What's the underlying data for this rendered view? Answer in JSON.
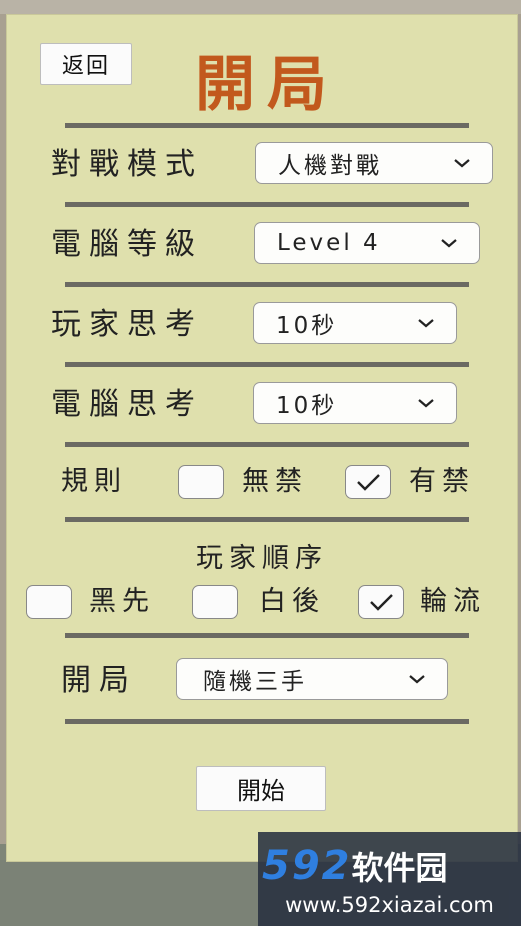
{
  "back_button": {
    "label": "返回"
  },
  "title": "開局",
  "rows": {
    "mode": {
      "label": "對戰模式",
      "value": "人機對戰"
    },
    "level": {
      "label": "電腦等級",
      "value": "Level 4"
    },
    "player_think": {
      "label": "玩家思考",
      "value": "10秒"
    },
    "computer_think": {
      "label": "電腦思考",
      "value": "10秒"
    },
    "rules": {
      "label": "規則",
      "options": [
        {
          "label": "無禁",
          "checked": false
        },
        {
          "label": "有禁",
          "checked": true
        }
      ]
    },
    "order": {
      "label": "玩家順序",
      "options": [
        {
          "label": "黑先",
          "checked": false
        },
        {
          "label": "白後",
          "checked": false
        },
        {
          "label": "輪流",
          "checked": true
        }
      ]
    },
    "opening": {
      "label": "開局",
      "value": "隨機三手"
    }
  },
  "start_button": {
    "label": "開始"
  },
  "watermark": {
    "logo_num": "592",
    "logo_text": "软件园",
    "url": "www.592xiazai.com"
  },
  "colors": {
    "panel": "#dfe0ad",
    "title": "#c2591d",
    "divider": "#6b6a63"
  }
}
